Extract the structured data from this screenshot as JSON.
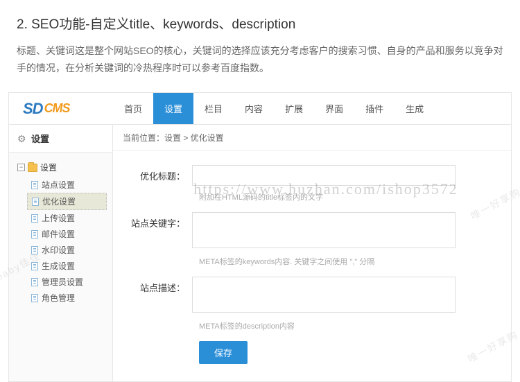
{
  "article": {
    "title": "2. SEO功能-自定义title、keywords、description",
    "desc": "标题、关键词这是整个网站SEO的核心，关键词的选择应该充分考虑客户的搜索习惯、自身的产品和服务以竞争对手的情况，在分析关键词的冷热程序时可以参考百度指数。"
  },
  "logo": {
    "sd": "SD",
    "cms": "CMS"
  },
  "nav": [
    {
      "label": "首页",
      "active": false
    },
    {
      "label": "设置",
      "active": true
    },
    {
      "label": "栏目",
      "active": false
    },
    {
      "label": "内容",
      "active": false
    },
    {
      "label": "扩展",
      "active": false
    },
    {
      "label": "界面",
      "active": false
    },
    {
      "label": "插件",
      "active": false
    },
    {
      "label": "生成",
      "active": false
    }
  ],
  "sidebar": {
    "header": "设置",
    "root": "设置",
    "items": [
      {
        "label": "站点设置",
        "active": false
      },
      {
        "label": "优化设置",
        "active": true
      },
      {
        "label": "上传设置",
        "active": false
      },
      {
        "label": "邮件设置",
        "active": false
      },
      {
        "label": "水印设置",
        "active": false
      },
      {
        "label": "生成设置",
        "active": false
      },
      {
        "label": "管理员设置",
        "active": false
      },
      {
        "label": "角色管理",
        "active": false
      }
    ]
  },
  "breadcrumb": "当前位置：设置 > 优化设置",
  "form": {
    "title_label": "优化标题：",
    "title_value": "",
    "title_hint": "附加在HTML源码的title标签内的文字",
    "keywords_label": "站点关键字：",
    "keywords_value": "",
    "keywords_hint": "META标签的keywords内容. 关键字之间使用 \",\" 分隔",
    "desc_label": "站点描述：",
    "desc_value": "",
    "desc_hint": "META标签的description内容",
    "save": "保存"
  },
  "watermark": "https://www.huzhan.com/ishop3572",
  "wm_side1": "唯一好享购",
  "wm_side2": "baby佳佳"
}
